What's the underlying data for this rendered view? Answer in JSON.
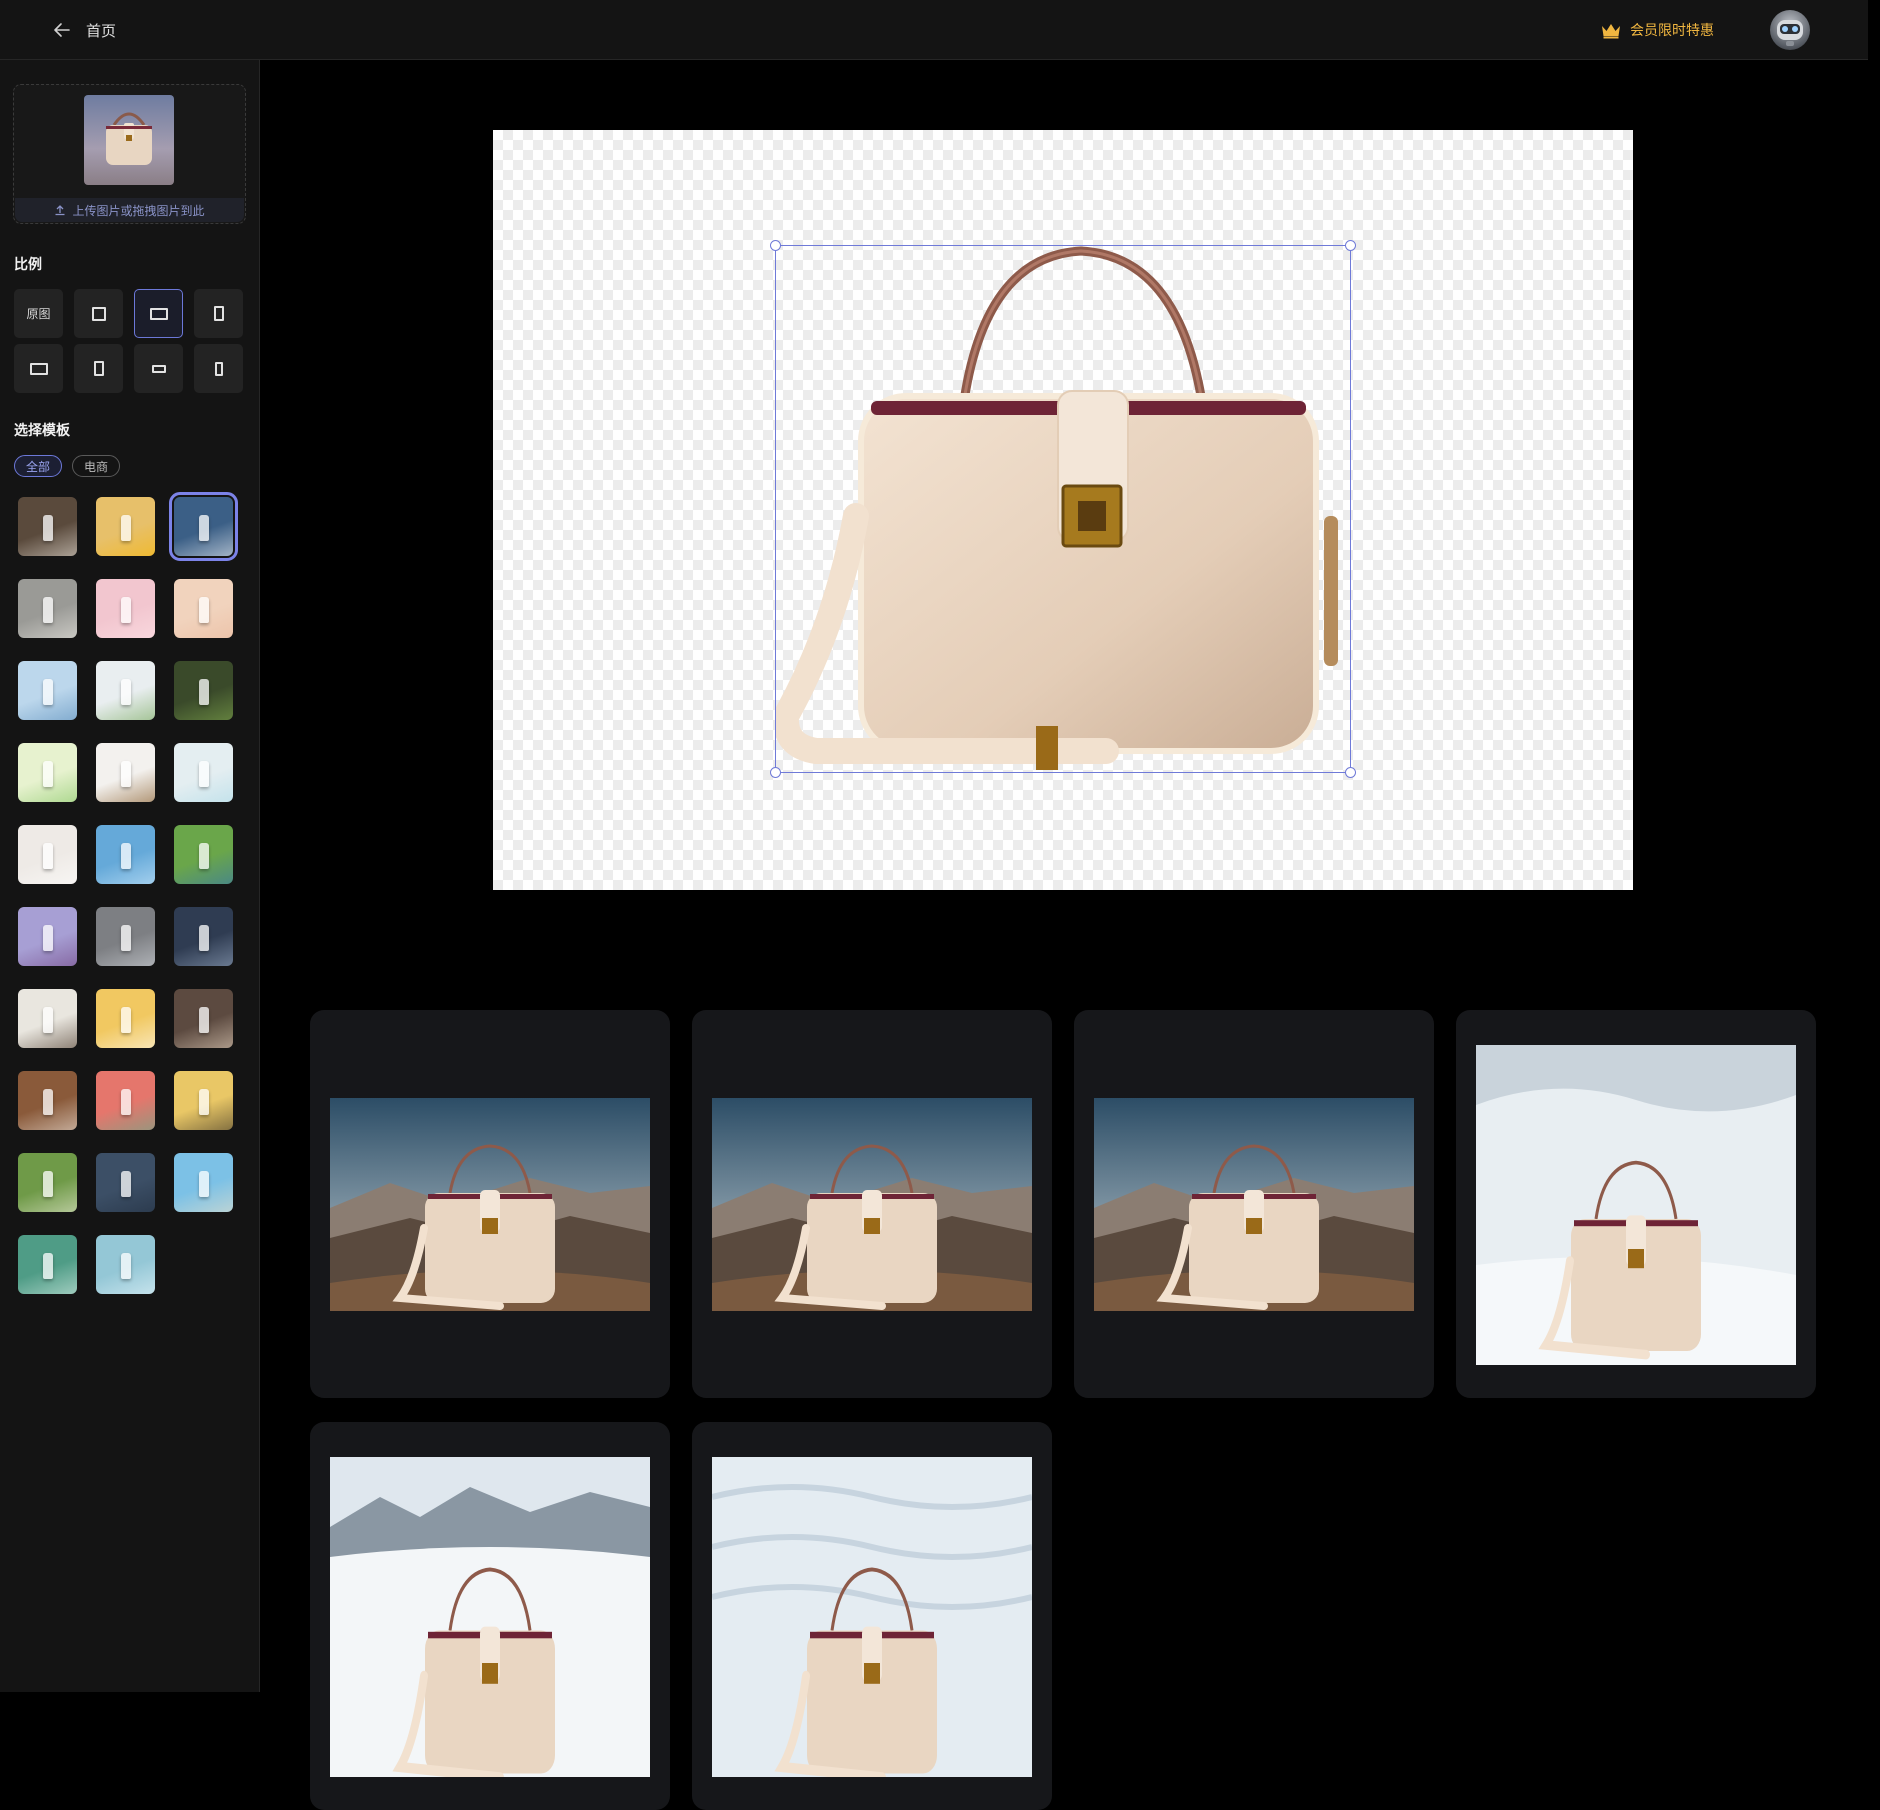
{
  "header": {
    "back_label": "首页",
    "vip_label": "会员限时特惠",
    "colors": {
      "vip": "#f0b640",
      "accent": "#6c78d8"
    }
  },
  "sidebar": {
    "upload_hint": "上传图片或拖拽图片到此",
    "ratio_title": "比例",
    "ratios": [
      {
        "label": "原图",
        "shape": "text"
      },
      {
        "shape": "square"
      },
      {
        "shape": "landscape",
        "active": true
      },
      {
        "shape": "portrait"
      },
      {
        "shape": "landscape"
      },
      {
        "shape": "portrait"
      },
      {
        "shape": "wide"
      },
      {
        "shape": "tall"
      }
    ],
    "template_title": "选择模板",
    "tags": [
      {
        "label": "全部",
        "active": true
      },
      {
        "label": "电商",
        "active": false
      }
    ],
    "templates": [
      {
        "bg": "#5a4a3c",
        "accent": "#f4efe6"
      },
      {
        "bg": "#e7c06a",
        "accent": "#f6b400"
      },
      {
        "bg": "#3b5f86",
        "accent": "#ffffff",
        "active": true
      },
      {
        "bg": "#9a9a96",
        "accent": "#f2f0ea"
      },
      {
        "bg": "#f2c6cf",
        "accent": "#ffe6ea"
      },
      {
        "bg": "#f1d3bd",
        "accent": "#e9b79a"
      },
      {
        "bg": "#bcd7ec",
        "accent": "#4f86b6"
      },
      {
        "bg": "#e9eef0",
        "accent": "#69a04a"
      },
      {
        "bg": "#3a4a2a",
        "accent": "#86b050"
      },
      {
        "bg": "#e7f2cf",
        "accent": "#7cc25a"
      },
      {
        "bg": "#f3f1ee",
        "accent": "#7a4a12"
      },
      {
        "bg": "#e4eef1",
        "accent": "#a7d8e6"
      },
      {
        "bg": "#eeeae6",
        "accent": "#ffffff"
      },
      {
        "bg": "#65a9d9",
        "accent": "#d9f0ff"
      },
      {
        "bg": "#6aa64a",
        "accent": "#2e6fb8"
      },
      {
        "bg": "#a79fd4",
        "accent": "#6b3c7a"
      },
      {
        "bg": "#7d7f83",
        "accent": "#d9dde2"
      },
      {
        "bg": "#2f3c52",
        "accent": "#9fb1c9"
      },
      {
        "bg": "#e9e6df",
        "accent": "#3e2a1a"
      },
      {
        "bg": "#f1c861",
        "accent": "#ffffff"
      },
      {
        "bg": "#5c4a40",
        "accent": "#f1dfc9"
      },
      {
        "bg": "#8a5a3a",
        "accent": "#f4efe8"
      },
      {
        "bg": "#e5766c",
        "accent": "#58b08c"
      },
      {
        "bg": "#e9c766",
        "accent": "#2a2420"
      },
      {
        "bg": "#6f9a48",
        "accent": "#f4f1e2"
      },
      {
        "bg": "#3c4f66",
        "accent": "#1e2a3a"
      },
      {
        "bg": "#7cc1e6",
        "accent": "#f2e3c6"
      },
      {
        "bg": "#4f9c86",
        "accent": "#e6f6f0"
      },
      {
        "bg": "#94c7d6",
        "accent": "#f1fbff"
      }
    ]
  },
  "results": [
    {
      "scene": "mountain"
    },
    {
      "scene": "mountain"
    },
    {
      "scene": "mountain"
    },
    {
      "scene": "snow"
    },
    {
      "scene": "snow-mountain"
    },
    {
      "scene": "snow-texture"
    }
  ]
}
